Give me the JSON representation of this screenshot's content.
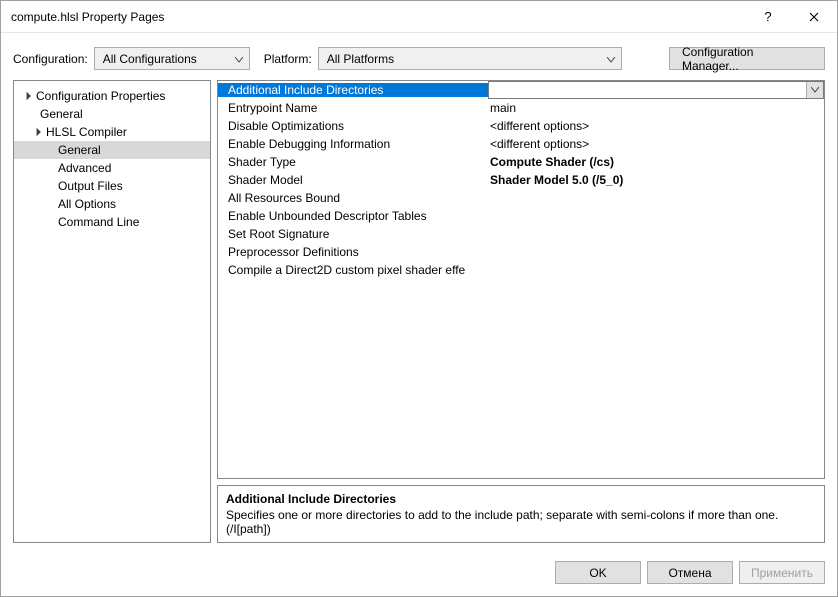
{
  "window": {
    "title": "compute.hlsl Property Pages"
  },
  "config": {
    "labelConfiguration": "Configuration:",
    "valueConfiguration": "All Configurations",
    "labelPlatform": "Platform:",
    "valuePlatform": "All Platforms",
    "buttonManager": "Configuration Manager..."
  },
  "tree": {
    "root": "Configuration Properties",
    "general": "General",
    "hlsl": "HLSL Compiler",
    "items": {
      "general": "General",
      "advanced": "Advanced",
      "outputFiles": "Output Files",
      "allOptions": "All Options",
      "commandLine": "Command Line"
    }
  },
  "grid": {
    "rows": [
      {
        "name": "Additional Include Directories",
        "value": "",
        "selected": true
      },
      {
        "name": "Entrypoint Name",
        "value": "main"
      },
      {
        "name": "Disable Optimizations",
        "value": "<different options>"
      },
      {
        "name": "Enable Debugging Information",
        "value": "<different options>"
      },
      {
        "name": "Shader Type",
        "value": "Compute Shader (/cs)",
        "bold": true
      },
      {
        "name": "Shader Model",
        "value": "Shader Model 5.0 (/5_0)",
        "bold": true
      },
      {
        "name": "All Resources Bound",
        "value": ""
      },
      {
        "name": "Enable Unbounded Descriptor Tables",
        "value": ""
      },
      {
        "name": "Set Root Signature",
        "value": ""
      },
      {
        "name": "Preprocessor Definitions",
        "value": ""
      },
      {
        "name": "Compile a Direct2D custom pixel shader effe",
        "value": ""
      }
    ]
  },
  "description": {
    "title": "Additional Include Directories",
    "body": "Specifies one or more directories to add to the include path; separate with semi-colons if more than one. (/I[path])"
  },
  "footer": {
    "ok": "OK",
    "cancel": "Отмена",
    "apply": "Применить"
  }
}
